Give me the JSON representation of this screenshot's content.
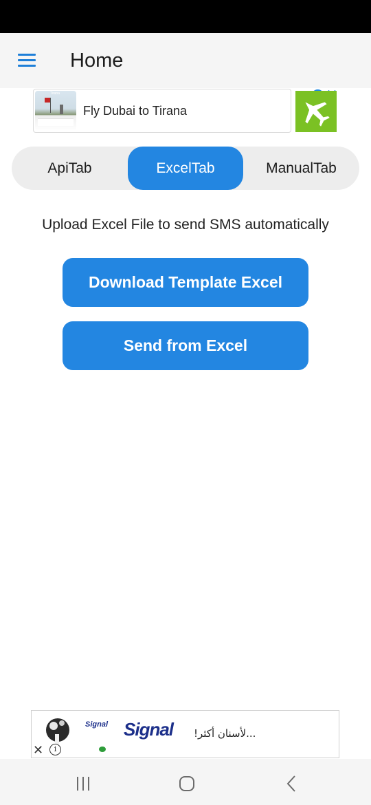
{
  "app_bar": {
    "title": "Home",
    "accent_color": "#1e7fd8",
    "menu_icon": "hamburger-menu-icon"
  },
  "top_ad": {
    "text": "Fly Dubai to Tirana",
    "thumbnail_caption": "Tirana",
    "choices_icon": "info-icon",
    "close_icon": "close-icon",
    "cta_icon": "airplane-icon",
    "cta_color": "#7bc124"
  },
  "tabs": {
    "items": [
      {
        "label": "ApiTab",
        "active": false
      },
      {
        "label": "ExcelTab",
        "active": true
      },
      {
        "label": "ManualTab",
        "active": false
      }
    ],
    "active_color": "#2386e1"
  },
  "main": {
    "description": "Upload Excel File to send SMS automatically",
    "download_button_label": "Download Template Excel",
    "send_button_label": "Send from Excel",
    "button_color": "#2386e1"
  },
  "bottom_ad": {
    "brand_small": "Signal",
    "brand_logo": "Signal",
    "text": "...لأسنان أكثر!",
    "close_glyph": "✕",
    "info_glyph": "i"
  },
  "nav_bar": {
    "recents_icon": "recents-icon",
    "home_icon": "home-icon",
    "back_icon": "back-icon"
  }
}
